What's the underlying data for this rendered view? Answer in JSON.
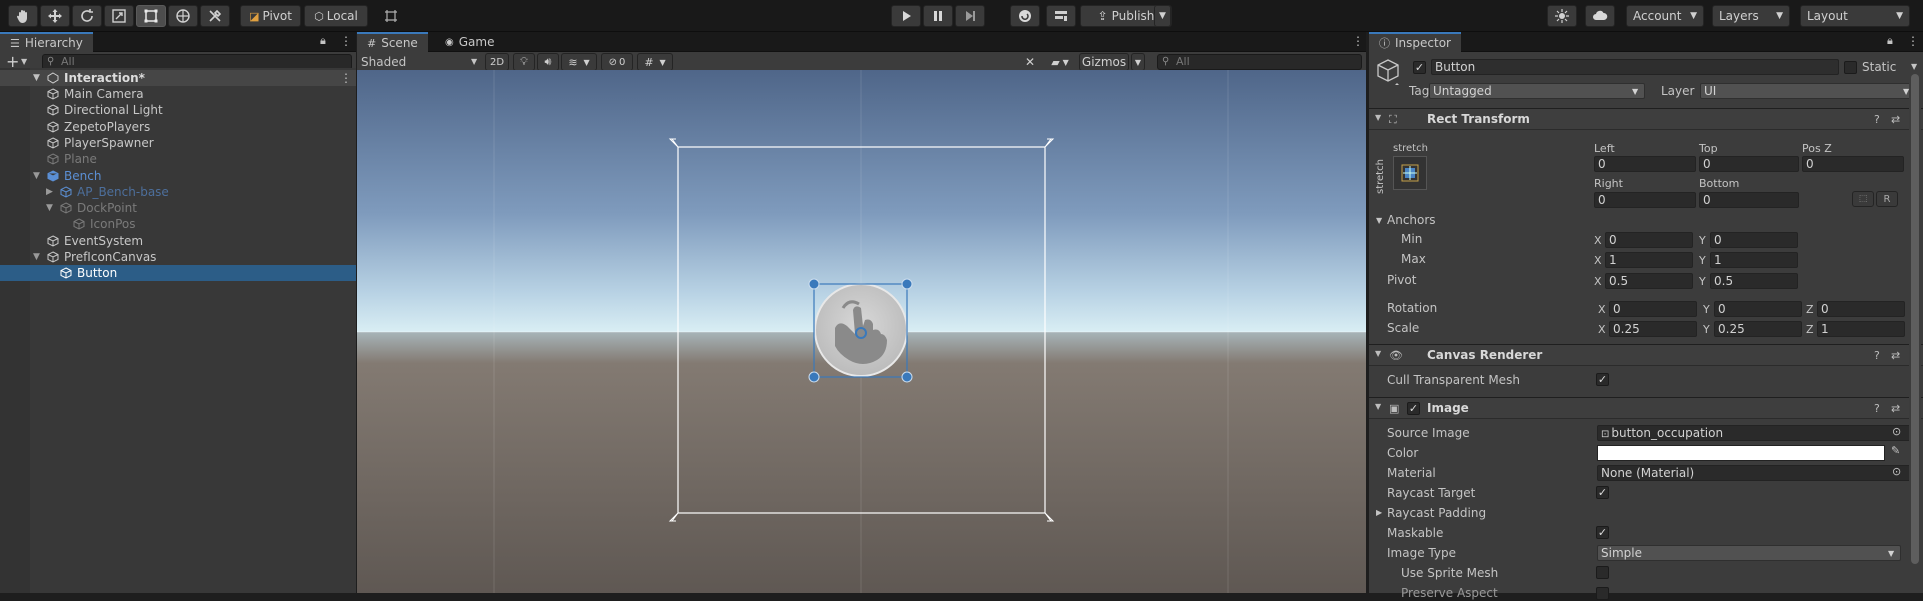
{
  "toolbar": {
    "pivot": "Pivot",
    "local": "Local",
    "publish": "Publish",
    "account": "Account",
    "layers": "Layers",
    "layout": "Layout"
  },
  "hierarchy": {
    "tab": "Hierarchy",
    "search_placeholder": "All",
    "scene": "Interaction*",
    "items": [
      {
        "label": "Main Camera",
        "indent": 1,
        "state": "normal",
        "arrow": ""
      },
      {
        "label": "Directional Light",
        "indent": 1,
        "state": "normal",
        "arrow": ""
      },
      {
        "label": "ZepetoPlayers",
        "indent": 1,
        "state": "normal",
        "arrow": ""
      },
      {
        "label": "PlayerSpawner",
        "indent": 1,
        "state": "normal",
        "arrow": ""
      },
      {
        "label": "Plane",
        "indent": 1,
        "state": "disabled",
        "arrow": ""
      },
      {
        "label": "Bench",
        "indent": 1,
        "state": "prefab",
        "arrow": "▼"
      },
      {
        "label": "AP_Bench-base",
        "indent": 2,
        "state": "prefab-dim",
        "arrow": "▶"
      },
      {
        "label": "DockPoint",
        "indent": 2,
        "state": "dim",
        "arrow": "▼"
      },
      {
        "label": "IconPos",
        "indent": 3,
        "state": "dim",
        "arrow": ""
      },
      {
        "label": "EventSystem",
        "indent": 1,
        "state": "normal",
        "arrow": ""
      },
      {
        "label": "PrefIconCanvas",
        "indent": 1,
        "state": "normal",
        "arrow": "▼"
      },
      {
        "label": "Button",
        "indent": 2,
        "state": "selected",
        "arrow": ""
      }
    ]
  },
  "scene_view": {
    "tab_scene": "Scene",
    "tab_game": "Game",
    "shading": "Shaded",
    "mode_2d": "2D",
    "hidden_count": "0",
    "gizmos": "Gizmos",
    "search_placeholder": "All"
  },
  "inspector": {
    "tab": "Inspector",
    "object_name": "Button",
    "static_label": "Static",
    "tag_label": "Tag",
    "tag_value": "Untagged",
    "layer_label": "Layer",
    "layer_value": "UI",
    "rect": {
      "title": "Rect Transform",
      "anchor_preset": "stretch",
      "left_label": "Left",
      "left": "0",
      "top_label": "Top",
      "top": "0",
      "posz_label": "Pos Z",
      "posz": "0",
      "right_label": "Right",
      "right": "0",
      "bottom_label": "Bottom",
      "bottom": "0",
      "r_button": "R",
      "anchors_label": "Anchors",
      "min_label": "Min",
      "min_x": "0",
      "min_y": "0",
      "max_label": "Max",
      "max_x": "1",
      "max_y": "1",
      "pivot_label": "Pivot",
      "pivot_x": "0.5",
      "pivot_y": "0.5",
      "rotation_label": "Rotation",
      "rot_x": "0",
      "rot_y": "0",
      "rot_z": "0",
      "scale_label": "Scale",
      "scale_x": "0.25",
      "scale_y": "0.25",
      "scale_z": "1",
      "x": "X",
      "y": "Y",
      "z": "Z"
    },
    "canvas_renderer": {
      "title": "Canvas Renderer",
      "cull_label": "Cull Transparent Mesh"
    },
    "image": {
      "title": "Image",
      "source_label": "Source Image",
      "source_value": "button_occupation",
      "color_label": "Color",
      "color_value": "#ffffff",
      "material_label": "Material",
      "material_value": "None (Material)",
      "raycast_label": "Raycast Target",
      "padding_label": "Raycast Padding",
      "maskable_label": "Maskable",
      "type_label": "Image Type",
      "type_value": "Simple",
      "sprite_mesh_label": "Use Sprite Mesh",
      "preserve_label": "Preserve Aspect"
    }
  },
  "colors": {
    "selection": "#2c5d87",
    "accent": "#3a79bb",
    "prefab": "#5b8fd4",
    "sky_top": "#4f6689",
    "sky_horizon": "#cfe7f0",
    "ground": "#6d6560"
  }
}
